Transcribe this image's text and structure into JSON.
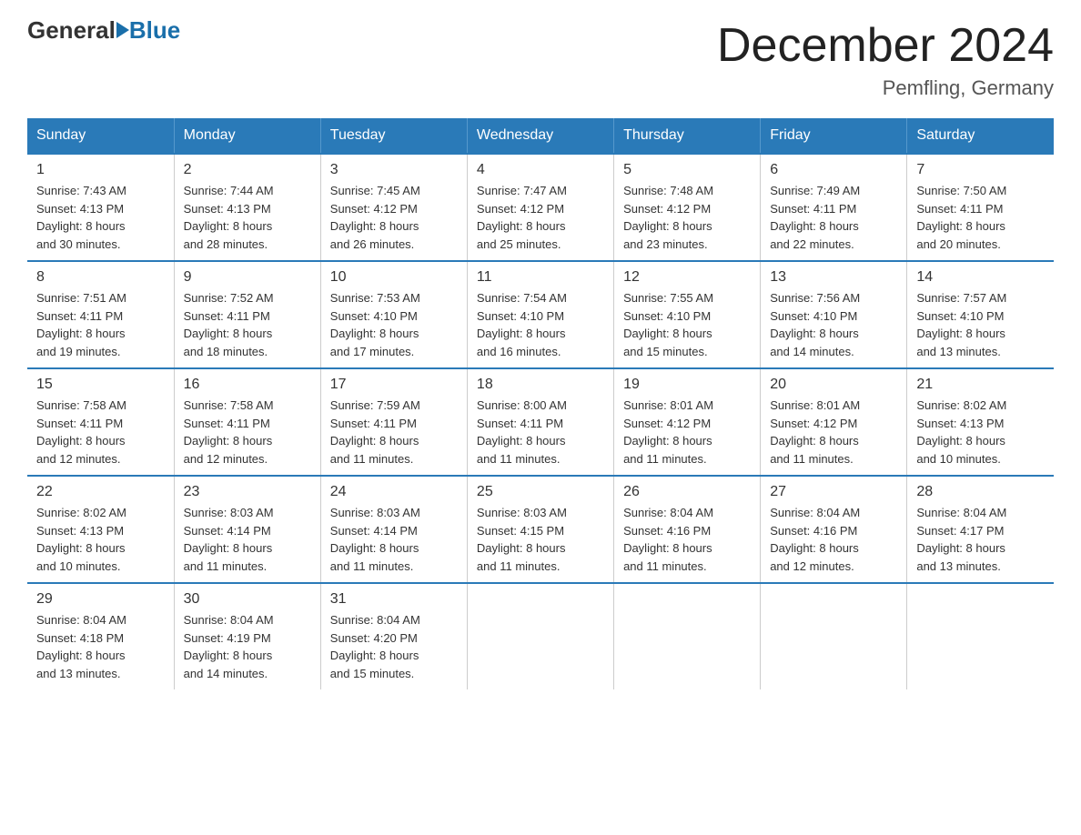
{
  "header": {
    "logo_general": "General",
    "logo_blue": "Blue",
    "month_title": "December 2024",
    "location": "Pemfling, Germany"
  },
  "days_of_week": [
    "Sunday",
    "Monday",
    "Tuesday",
    "Wednesday",
    "Thursday",
    "Friday",
    "Saturday"
  ],
  "weeks": [
    [
      {
        "day": "1",
        "sunrise": "7:43 AM",
        "sunset": "4:13 PM",
        "daylight": "8 hours and 30 minutes."
      },
      {
        "day": "2",
        "sunrise": "7:44 AM",
        "sunset": "4:13 PM",
        "daylight": "8 hours and 28 minutes."
      },
      {
        "day": "3",
        "sunrise": "7:45 AM",
        "sunset": "4:12 PM",
        "daylight": "8 hours and 26 minutes."
      },
      {
        "day": "4",
        "sunrise": "7:47 AM",
        "sunset": "4:12 PM",
        "daylight": "8 hours and 25 minutes."
      },
      {
        "day": "5",
        "sunrise": "7:48 AM",
        "sunset": "4:12 PM",
        "daylight": "8 hours and 23 minutes."
      },
      {
        "day": "6",
        "sunrise": "7:49 AM",
        "sunset": "4:11 PM",
        "daylight": "8 hours and 22 minutes."
      },
      {
        "day": "7",
        "sunrise": "7:50 AM",
        "sunset": "4:11 PM",
        "daylight": "8 hours and 20 minutes."
      }
    ],
    [
      {
        "day": "8",
        "sunrise": "7:51 AM",
        "sunset": "4:11 PM",
        "daylight": "8 hours and 19 minutes."
      },
      {
        "day": "9",
        "sunrise": "7:52 AM",
        "sunset": "4:11 PM",
        "daylight": "8 hours and 18 minutes."
      },
      {
        "day": "10",
        "sunrise": "7:53 AM",
        "sunset": "4:10 PM",
        "daylight": "8 hours and 17 minutes."
      },
      {
        "day": "11",
        "sunrise": "7:54 AM",
        "sunset": "4:10 PM",
        "daylight": "8 hours and 16 minutes."
      },
      {
        "day": "12",
        "sunrise": "7:55 AM",
        "sunset": "4:10 PM",
        "daylight": "8 hours and 15 minutes."
      },
      {
        "day": "13",
        "sunrise": "7:56 AM",
        "sunset": "4:10 PM",
        "daylight": "8 hours and 14 minutes."
      },
      {
        "day": "14",
        "sunrise": "7:57 AM",
        "sunset": "4:10 PM",
        "daylight": "8 hours and 13 minutes."
      }
    ],
    [
      {
        "day": "15",
        "sunrise": "7:58 AM",
        "sunset": "4:11 PM",
        "daylight": "8 hours and 12 minutes."
      },
      {
        "day": "16",
        "sunrise": "7:58 AM",
        "sunset": "4:11 PM",
        "daylight": "8 hours and 12 minutes."
      },
      {
        "day": "17",
        "sunrise": "7:59 AM",
        "sunset": "4:11 PM",
        "daylight": "8 hours and 11 minutes."
      },
      {
        "day": "18",
        "sunrise": "8:00 AM",
        "sunset": "4:11 PM",
        "daylight": "8 hours and 11 minutes."
      },
      {
        "day": "19",
        "sunrise": "8:01 AM",
        "sunset": "4:12 PM",
        "daylight": "8 hours and 11 minutes."
      },
      {
        "day": "20",
        "sunrise": "8:01 AM",
        "sunset": "4:12 PM",
        "daylight": "8 hours and 11 minutes."
      },
      {
        "day": "21",
        "sunrise": "8:02 AM",
        "sunset": "4:13 PM",
        "daylight": "8 hours and 10 minutes."
      }
    ],
    [
      {
        "day": "22",
        "sunrise": "8:02 AM",
        "sunset": "4:13 PM",
        "daylight": "8 hours and 10 minutes."
      },
      {
        "day": "23",
        "sunrise": "8:03 AM",
        "sunset": "4:14 PM",
        "daylight": "8 hours and 11 minutes."
      },
      {
        "day": "24",
        "sunrise": "8:03 AM",
        "sunset": "4:14 PM",
        "daylight": "8 hours and 11 minutes."
      },
      {
        "day": "25",
        "sunrise": "8:03 AM",
        "sunset": "4:15 PM",
        "daylight": "8 hours and 11 minutes."
      },
      {
        "day": "26",
        "sunrise": "8:04 AM",
        "sunset": "4:16 PM",
        "daylight": "8 hours and 11 minutes."
      },
      {
        "day": "27",
        "sunrise": "8:04 AM",
        "sunset": "4:16 PM",
        "daylight": "8 hours and 12 minutes."
      },
      {
        "day": "28",
        "sunrise": "8:04 AM",
        "sunset": "4:17 PM",
        "daylight": "8 hours and 13 minutes."
      }
    ],
    [
      {
        "day": "29",
        "sunrise": "8:04 AM",
        "sunset": "4:18 PM",
        "daylight": "8 hours and 13 minutes."
      },
      {
        "day": "30",
        "sunrise": "8:04 AM",
        "sunset": "4:19 PM",
        "daylight": "8 hours and 14 minutes."
      },
      {
        "day": "31",
        "sunrise": "8:04 AM",
        "sunset": "4:20 PM",
        "daylight": "8 hours and 15 minutes."
      },
      null,
      null,
      null,
      null
    ]
  ],
  "labels": {
    "sunrise": "Sunrise:",
    "sunset": "Sunset:",
    "daylight": "Daylight:"
  }
}
